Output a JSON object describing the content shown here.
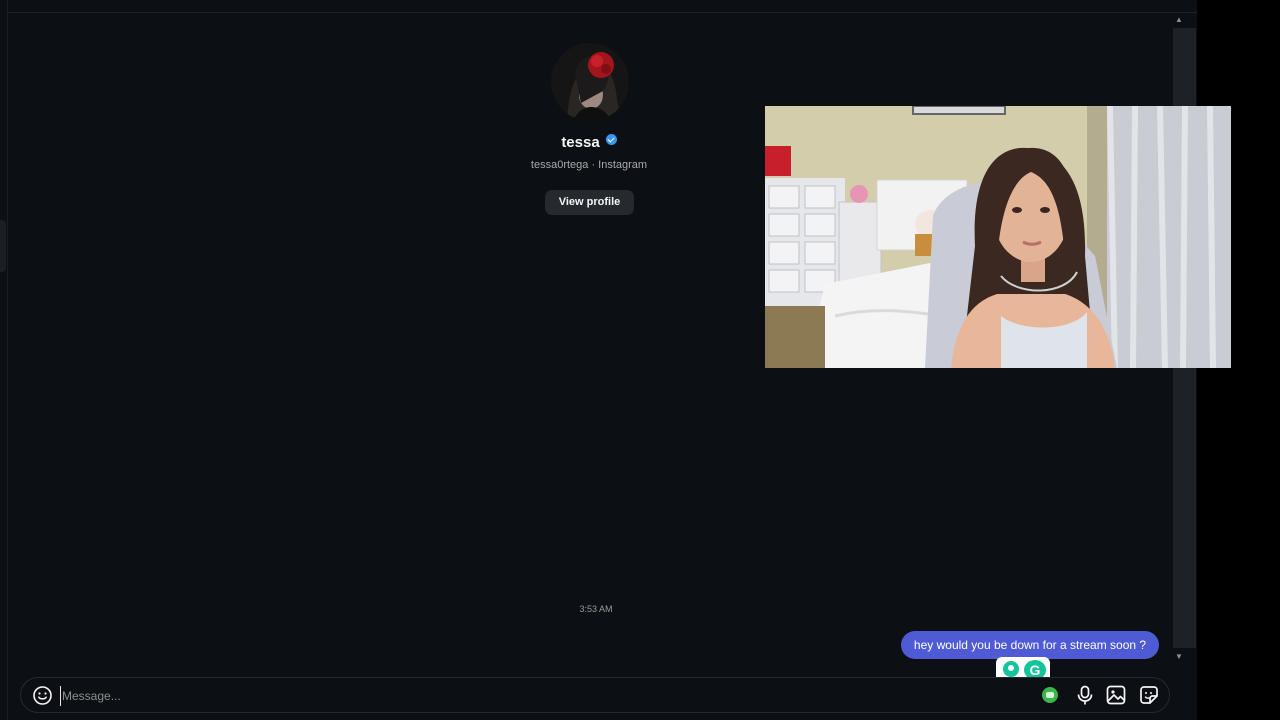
{
  "profile": {
    "name": "tessa",
    "subtitle": "tessa0rtega · Instagram",
    "view_profile_label": "View profile"
  },
  "conversation": {
    "timestamp": "3:53 AM",
    "messages": [
      {
        "from": "me",
        "text": "hey would you be down for a stream soon ?"
      }
    ]
  },
  "composer": {
    "placeholder": "Message..."
  },
  "icons": {
    "emoji": "smile-icon",
    "voice": "microphone-icon",
    "media": "image-icon",
    "sticker": "sticker-icon",
    "grammarly": "grammarly-icon",
    "extension": "extension-icon"
  },
  "colors": {
    "background": "#0c1014",
    "bubble": "#4f5bd5",
    "verified": "#3897f0",
    "grammarly": "#15c39a"
  }
}
